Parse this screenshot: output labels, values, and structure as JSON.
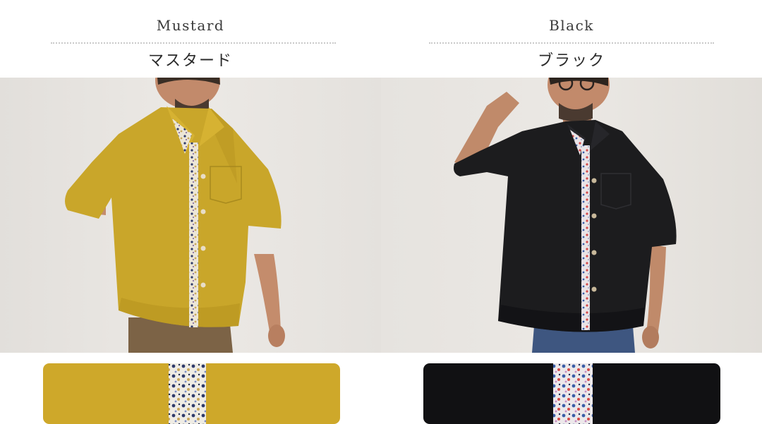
{
  "colors": [
    {
      "name_en": "Mustard",
      "name_ja": "マスタード",
      "shirt_color": "#c9a62a",
      "swatch_color": "#d2ad2c"
    },
    {
      "name_en": "Black",
      "name_ja": "ブラック",
      "shirt_color": "#1c1c1e",
      "swatch_color": "#111113"
    }
  ],
  "palette": {
    "background": "#ffffff",
    "wall": "#e7e4e0",
    "divider_dots": "#c9c9c9",
    "floral_base": "#efece6",
    "floral_accents": [
      "#2f3b6b",
      "#c9a75a",
      "#7a5a9a",
      "#d44a4a",
      "#3a5ea8",
      "#9aa6c8"
    ]
  },
  "images": {
    "left_photo": "man-in-mustard-shirt-photo",
    "right_photo": "man-in-black-shirt-photo",
    "left_swatch": "mustard-fabric-swatch",
    "right_swatch": "black-fabric-swatch"
  }
}
